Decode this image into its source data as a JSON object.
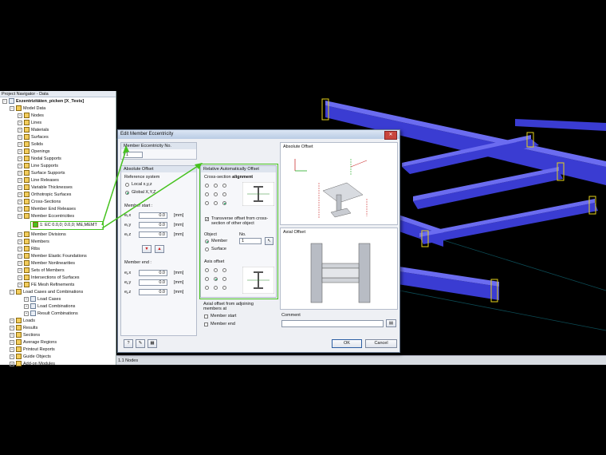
{
  "navigator": {
    "title": "Project Navigator - Data",
    "project": "Exzentrizitäten_picken [X_Tests]",
    "model_data": "Model Data",
    "items": [
      "Nodes",
      "Lines",
      "Materials",
      "Surfaces",
      "Solids",
      "Openings",
      "Nodal Supports",
      "Line Supports",
      "Surface Supports",
      "Line Releases",
      "Variable Thicknesses",
      "Orthotropic Surfaces",
      "Cross-Sections",
      "Member End Releases",
      "Member Eccentricities"
    ],
    "selected_item": "1: EC 0.0,0; 0.0,0; ME,MEMT",
    "items2": [
      "Member Divisions",
      "Members",
      "Ribs",
      "Member Elastic Foundations",
      "Member Nonlinearities",
      "Sets of Members",
      "Intersections of Surfaces",
      "FE Mesh Refinements"
    ],
    "load_cases_group": "Load Cases and Combinations",
    "load_items": [
      "Load Cases",
      "Load Combinations",
      "Result Combinations"
    ],
    "root_items": [
      "Loads",
      "Results",
      "Sections",
      "Average Regions",
      "Printout Reports",
      "Guide Objects",
      "Add-on Modules"
    ]
  },
  "statusbar": {
    "text": "1.1 Nodes"
  },
  "dialog": {
    "title": "Edit Member Eccentricity",
    "ecc_no_label": "Member Eccentricity No.",
    "ecc_no_value": "1",
    "absolute_offset_header": "Absolute Offset",
    "ref_system_label": "Reference system",
    "local_label": "Local x,y,z",
    "global_label": "Global X,Y,Z",
    "member_start_label": "Member start :",
    "member_end_label": "Member end :",
    "start_rows": [
      {
        "label": "eᵢ,x",
        "value": "0.0",
        "unit": "[mm]"
      },
      {
        "label": "eᵢ,y",
        "value": "0.0",
        "unit": "[mm]"
      },
      {
        "label": "eᵢ,z",
        "value": "0.0",
        "unit": "[mm]"
      }
    ],
    "end_rows": [
      {
        "label": "eⱼ,x",
        "value": "0.0",
        "unit": "[mm]"
      },
      {
        "label": "eⱼ,y",
        "value": "0.0",
        "unit": "[mm]"
      },
      {
        "label": "eⱼ,z",
        "value": "0.0",
        "unit": "[mm]"
      }
    ],
    "rel_offset_header": "Relative Automatically Offset",
    "cross_section_label": "Cross-section",
    "cross_section_value": "alignment",
    "transverse_label": "Transverse offset from cross-section of other object",
    "object_label": "Object",
    "no_label": "No.",
    "member_label": "Member",
    "surface_label": "Surface",
    "object_no": "1",
    "axis_offset_label": "Axis offset",
    "axial_adjoin_label": "Axial offset from adjoining members at",
    "member_start_chk": "Member start",
    "member_end_chk": "Member end",
    "absolute_offset_img_label": "Absolute Offset",
    "axial_offset_img_label": "Axial Offset",
    "comment_label": "Comment",
    "ok_label": "OK",
    "cancel_label": "Cancel"
  },
  "colors": {
    "beam": "#3d3fd6",
    "highlight_green": "#46c21f",
    "dialog_bg": "#eef0f4"
  }
}
